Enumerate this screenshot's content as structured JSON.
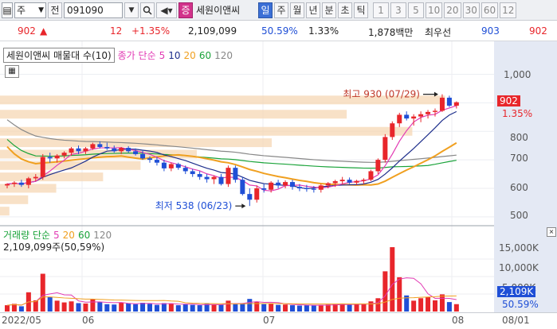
{
  "toolbar": {
    "main_select": "주",
    "jeon_label": "전",
    "code": "091090",
    "jeung_label": "증",
    "stock_name": "세원이앤씨",
    "periods": [
      "일",
      "주",
      "월",
      "년",
      "분",
      "초",
      "틱"
    ],
    "active_period": "일",
    "intervals": [
      "1",
      "3",
      "5",
      "10",
      "20",
      "30",
      "60",
      "12"
    ]
  },
  "quote": {
    "price": "902",
    "change_arrow": "▲",
    "change": "12",
    "change_pct": "+1.35%",
    "volume": "2,109,099",
    "vol_ratio": "50.59%",
    "turnover": "1.33%",
    "amount": "1,878백만",
    "best_label": "최우선",
    "ask": "903",
    "bid": "902"
  },
  "legend_main": {
    "name": "세원이앤씨",
    "extra": "매물대 수(10)",
    "ma_label": "종가 단순",
    "periods": [
      "5",
      "10",
      "20",
      "60",
      "120"
    ]
  },
  "legend_vol": {
    "label": "거래량 단순",
    "periods": [
      "5",
      "20",
      "60",
      "120"
    ],
    "value": "2,109,099주(50,59%)"
  },
  "price_axis": {
    "ticks": [
      "1,000",
      "900",
      "800",
      "700",
      "600",
      "500"
    ],
    "current_tag": "902",
    "current_pct": "1.35%"
  },
  "vol_axis": {
    "ticks": [
      "15,000K",
      "10,000K",
      "5,000K"
    ],
    "current_tag": "2,109K",
    "current_pct": "50.59%"
  },
  "dates": {
    "labels": [
      "2022/05",
      "06",
      "07",
      "08",
      "08/01"
    ]
  },
  "annotations": {
    "high": "최고 930 (07/29)",
    "low": "최저 538 (06/23)"
  },
  "colors": {
    "up": "#e8262b",
    "down": "#1f4fd6",
    "ma5": "#e23bb4",
    "ma10": "#1e2f8c",
    "ma20": "#f0a020",
    "ma60": "#1aa33a",
    "ma120": "#888888",
    "vp": "#f6d7b4"
  },
  "chart_data": {
    "type": "candlestick",
    "ylim": [
      480,
      1060
    ],
    "candles": [
      [
        610,
        618,
        600,
        615
      ],
      [
        615,
        625,
        605,
        620
      ],
      [
        620,
        630,
        605,
        612
      ],
      [
        612,
        640,
        600,
        635
      ],
      [
        635,
        650,
        625,
        640
      ],
      [
        640,
        720,
        630,
        710
      ],
      [
        710,
        725,
        690,
        705
      ],
      [
        705,
        720,
        690,
        715
      ],
      [
        715,
        730,
        705,
        725
      ],
      [
        725,
        745,
        715,
        740
      ],
      [
        740,
        750,
        720,
        730
      ],
      [
        730,
        745,
        720,
        740
      ],
      [
        740,
        760,
        735,
        755
      ],
      [
        755,
        765,
        740,
        745
      ],
      [
        745,
        760,
        735,
        740
      ],
      [
        740,
        750,
        725,
        730
      ],
      [
        730,
        745,
        720,
        742
      ],
      [
        742,
        748,
        725,
        730
      ],
      [
        730,
        740,
        715,
        720
      ],
      [
        720,
        735,
        700,
        705
      ],
      [
        705,
        712,
        690,
        700
      ],
      [
        700,
        710,
        680,
        690
      ],
      [
        690,
        700,
        660,
        670
      ],
      [
        670,
        690,
        660,
        685
      ],
      [
        685,
        690,
        665,
        672
      ],
      [
        672,
        680,
        650,
        660
      ],
      [
        660,
        668,
        640,
        650
      ],
      [
        650,
        660,
        630,
        640
      ],
      [
        640,
        650,
        620,
        632
      ],
      [
        632,
        645,
        615,
        640
      ],
      [
        640,
        650,
        610,
        615
      ],
      [
        615,
        680,
        605,
        672
      ],
      [
        672,
        680,
        620,
        630
      ],
      [
        630,
        640,
        575,
        580
      ],
      [
        580,
        600,
        538,
        560
      ],
      [
        560,
        610,
        550,
        600
      ],
      [
        600,
        615,
        585,
        595
      ],
      [
        595,
        625,
        585,
        620
      ],
      [
        620,
        630,
        600,
        610
      ],
      [
        610,
        628,
        600,
        622
      ],
      [
        622,
        630,
        595,
        605
      ],
      [
        605,
        615,
        590,
        600
      ],
      [
        600,
        612,
        588,
        598
      ],
      [
        598,
        608,
        585,
        595
      ],
      [
        595,
        615,
        585,
        610
      ],
      [
        610,
        622,
        600,
        618
      ],
      [
        618,
        630,
        605,
        625
      ],
      [
        625,
        640,
        615,
        630
      ],
      [
        630,
        638,
        615,
        620
      ],
      [
        620,
        630,
        612,
        626
      ],
      [
        626,
        635,
        615,
        630
      ],
      [
        630,
        665,
        625,
        660
      ],
      [
        660,
        705,
        650,
        700
      ],
      [
        700,
        790,
        690,
        780
      ],
      [
        780,
        835,
        770,
        828
      ],
      [
        828,
        865,
        815,
        858
      ],
      [
        858,
        870,
        838,
        845
      ],
      [
        845,
        860,
        820,
        852
      ],
      [
        852,
        870,
        832,
        860
      ],
      [
        860,
        875,
        845,
        868
      ],
      [
        868,
        880,
        852,
        872
      ],
      [
        872,
        930,
        868,
        918
      ],
      [
        918,
        925,
        885,
        890
      ],
      [
        890,
        905,
        880,
        902
      ]
    ],
    "volume_k": [
      1800,
      2200,
      1500,
      5500,
      3200,
      10800,
      4200,
      3100,
      2600,
      2900,
      2400,
      2300,
      3500,
      2700,
      2100,
      2000,
      2600,
      2300,
      2100,
      2500,
      2200,
      1900,
      2400,
      2300,
      1800,
      2100,
      1900,
      1800,
      2200,
      2000,
      1900,
      3100,
      2100,
      2400,
      3600,
      2800,
      2100,
      2300,
      1900,
      2000,
      1800,
      1700,
      1800,
      1700,
      1900,
      2000,
      2100,
      2200,
      1900,
      2000,
      2100,
      2900,
      3800,
      11500,
      18400,
      9800,
      4600,
      3100,
      3800,
      4100,
      3200,
      4900,
      2700,
      2109
    ],
    "vp_levels": [
      {
        "price": 910,
        "weight": 0.95
      },
      {
        "price": 860,
        "weight": 0.74
      },
      {
        "price": 800,
        "weight": 0.88
      },
      {
        "price": 760,
        "weight": 0.58
      },
      {
        "price": 720,
        "weight": 0.42
      },
      {
        "price": 680,
        "weight": 0.3
      },
      {
        "price": 640,
        "weight": 0.22
      },
      {
        "price": 600,
        "weight": 0.12
      },
      {
        "price": 560,
        "weight": 0.06
      },
      {
        "price": 520,
        "weight": 0.02
      }
    ]
  }
}
